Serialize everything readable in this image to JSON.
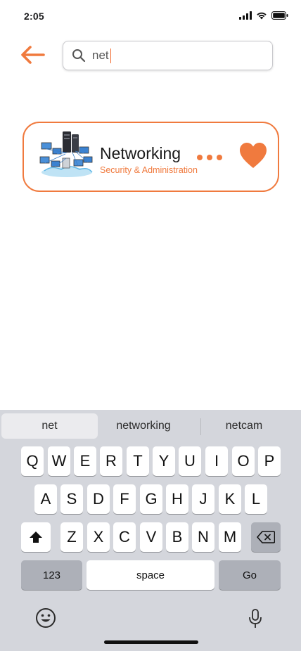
{
  "status_bar": {
    "time": "2:05"
  },
  "search": {
    "query": "net"
  },
  "result": {
    "title": "Networking",
    "subtitle": "Security & Administration"
  },
  "colors": {
    "accent": "#f07a3e",
    "keyboard_bg": "#d4d6dc",
    "dark_key": "#adb0b8"
  },
  "keyboard": {
    "suggestions": [
      "net",
      "networking",
      "netcam"
    ],
    "row1": [
      "Q",
      "W",
      "E",
      "R",
      "T",
      "Y",
      "U",
      "I",
      "O",
      "P"
    ],
    "row2": [
      "A",
      "S",
      "D",
      "F",
      "G",
      "H",
      "J",
      "K",
      "L"
    ],
    "row3": [
      "Z",
      "X",
      "C",
      "V",
      "B",
      "N",
      "M"
    ],
    "numbers_label": "123",
    "space_label": "space",
    "go_label": "Go"
  },
  "icons": {
    "back": "arrow-left-icon",
    "search": "magnifier-icon",
    "more": "ellipsis-icon",
    "favorite": "heart-icon",
    "shift": "shift-arrow-icon",
    "delete": "backspace-icon",
    "emoji": "smiley-icon",
    "mic": "microphone-icon"
  }
}
